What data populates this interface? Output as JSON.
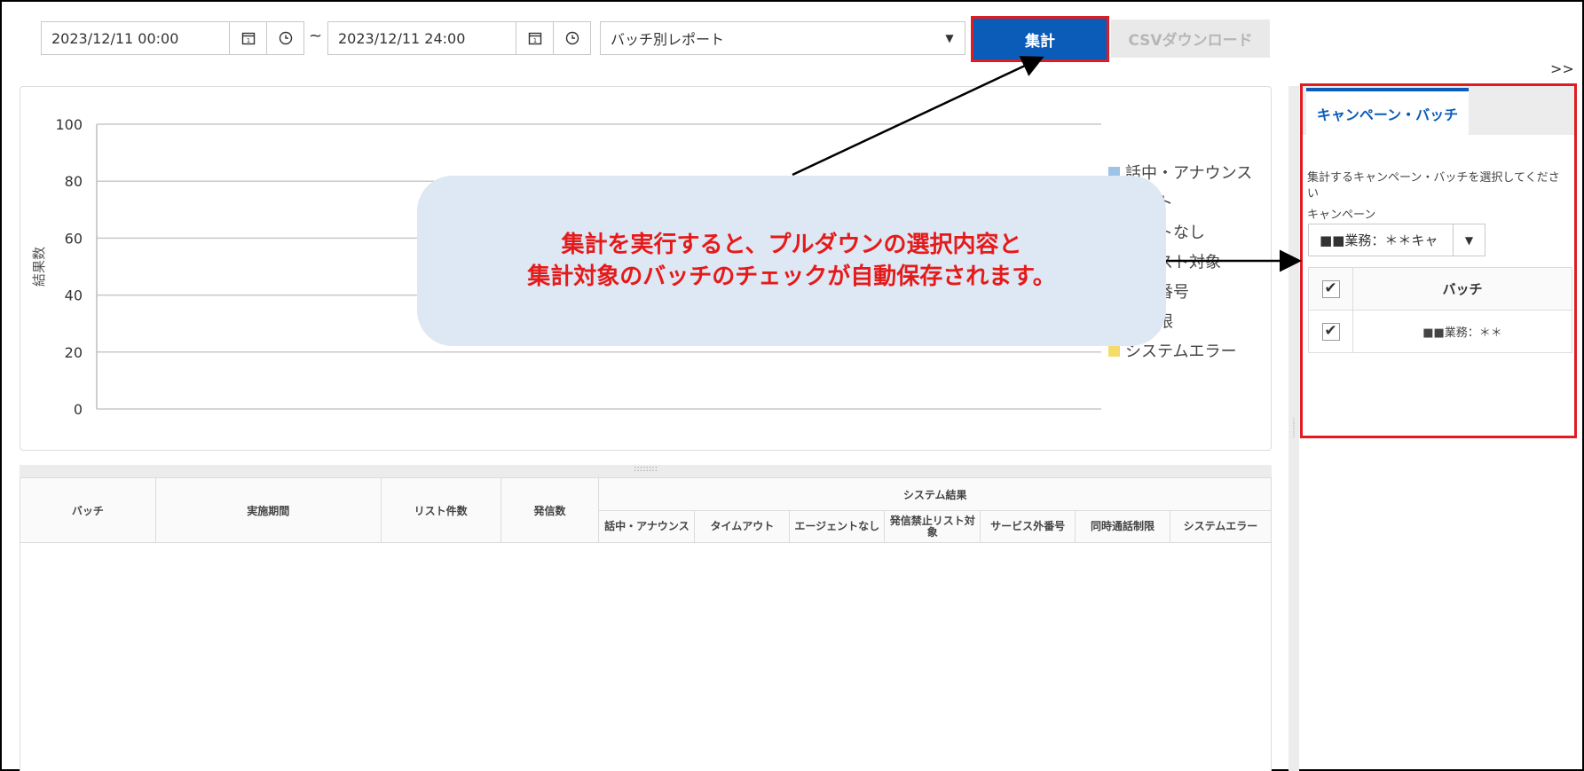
{
  "toolbar": {
    "start_datetime": "2023/12/11 00:00",
    "end_datetime": "2023/12/11 24:00",
    "range_separator": "~",
    "report_type": "バッチ別レポート",
    "aggregate_label": "集計",
    "csv_label": "CSVダウンロード",
    "calendar_glyph": "1",
    "collapse_label": ">>"
  },
  "chart_data": {
    "type": "bar",
    "ylabel": "結果数",
    "ylim": [
      0,
      100
    ],
    "yticks": [
      0,
      20,
      40,
      60,
      80,
      100
    ],
    "categories": [],
    "series": [
      {
        "name": "話中・アナウンス",
        "values": [],
        "color": "#9fc3e7"
      },
      {
        "name": "タイムアウト",
        "values": [],
        "color": "#f2a45f"
      },
      {
        "name": "エージェントなし",
        "values": [],
        "color": "#b7b7b7"
      },
      {
        "name": "発信禁止リスト対象",
        "values": [],
        "color": "#f5c518"
      },
      {
        "name": "サービス外番号",
        "values": [],
        "color": "#5b9bd5"
      },
      {
        "name": "同時通話制限",
        "values": [],
        "color": "#70ad47"
      },
      {
        "name": "システムエラー",
        "values": [],
        "color": "#f3dc6a"
      }
    ],
    "legend_visible_text": [
      "話中・アナウンス",
      "アウト",
      "ェントなし",
      "止リスト対象",
      "ス外番号",
      "話制限",
      "システムエラー"
    ],
    "legend_position": "right",
    "grid": true
  },
  "table": {
    "headers": {
      "batch": "バッチ",
      "period": "実施期間",
      "list_count": "リスト件数",
      "calls": "発信数",
      "system_result": "システム結果"
    },
    "system_result_columns": [
      "話中・アナウンス",
      "タイムアウト",
      "エージェントなし",
      "発信禁止リスト対象",
      "サービス外番号",
      "同時通話制限",
      "システムエラー"
    ]
  },
  "right_panel": {
    "tab_label": "キャンペーン・バッチ",
    "instruction": "集計するキャンペーン・バッチを選択してください",
    "campaign_label": "キャンペーン",
    "campaign_value": "■■業務：＊＊キャ",
    "batch_header": "バッチ",
    "batches": [
      {
        "name": "■■業務：＊＊",
        "checked": true
      }
    ],
    "check_glyph": "✔"
  },
  "callout": {
    "line1": "集計を実行すると、プルダウンの選択内容と",
    "line2": "集計対象のバッチのチェックが自動保存されます。"
  },
  "colors": {
    "accent": "#0b5cb8",
    "highlight": "#e01b22",
    "callout_bg": "#dde8f4",
    "callout_text": "#e51a1a"
  }
}
